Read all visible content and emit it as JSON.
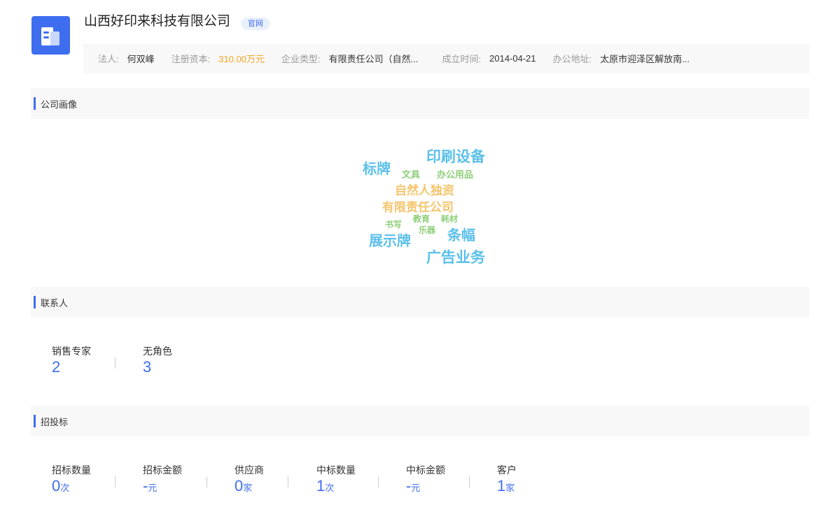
{
  "company": {
    "name": "山西好印来科技有限公司",
    "official_tag": "官网",
    "logo_icon": "building-icon",
    "brand_color": "#3f6df0"
  },
  "info": {
    "legal_person_label": "法人:",
    "legal_person": "何双峰",
    "capital_label": "注册资本:",
    "capital": "310.00万元",
    "type_label": "企业类型:",
    "type": "有限责任公司（自然...",
    "founded_label": "成立时间:",
    "founded": "2014-04-21",
    "address_label": "办公地址:",
    "address": "太原市迎泽区解放南..."
  },
  "sections": {
    "portrait": "公司画像",
    "contacts": "联系人",
    "bidding": "招投标"
  },
  "word_cloud": [
    {
      "text": "印刷设备",
      "color": "#5bc0eb"
    },
    {
      "text": "标牌",
      "color": "#5bc0eb"
    },
    {
      "text": "文具",
      "color": "#8fcf7a"
    },
    {
      "text": "办公用品",
      "color": "#8fcf7a"
    },
    {
      "text": "自然人独资",
      "color": "#f5c46a"
    },
    {
      "text": "有限责任公司",
      "color": "#f5c46a"
    },
    {
      "text": "书写",
      "color": "#8fcf7a"
    },
    {
      "text": "教育",
      "color": "#8fcf7a"
    },
    {
      "text": "耗材",
      "color": "#8fcf7a"
    },
    {
      "text": "乐器",
      "color": "#8fcf7a"
    },
    {
      "text": "条幅",
      "color": "#5bc0eb"
    },
    {
      "text": "展示牌",
      "color": "#5bc0eb"
    },
    {
      "text": "广告业务",
      "color": "#5bc0eb"
    }
  ],
  "contacts": [
    {
      "label": "销售专家",
      "value": "2",
      "unit": ""
    },
    {
      "label": "无角色",
      "value": "3",
      "unit": ""
    }
  ],
  "bidding": [
    {
      "label": "招标数量",
      "value": "0",
      "unit": "次"
    },
    {
      "label": "招标金额",
      "value": "-",
      "unit": "元"
    },
    {
      "label": "供应商",
      "value": "0",
      "unit": "家"
    },
    {
      "label": "中标数量",
      "value": "1",
      "unit": "次"
    },
    {
      "label": "中标金额",
      "value": "-",
      "unit": "元"
    },
    {
      "label": "客户",
      "value": "1",
      "unit": "家"
    }
  ]
}
